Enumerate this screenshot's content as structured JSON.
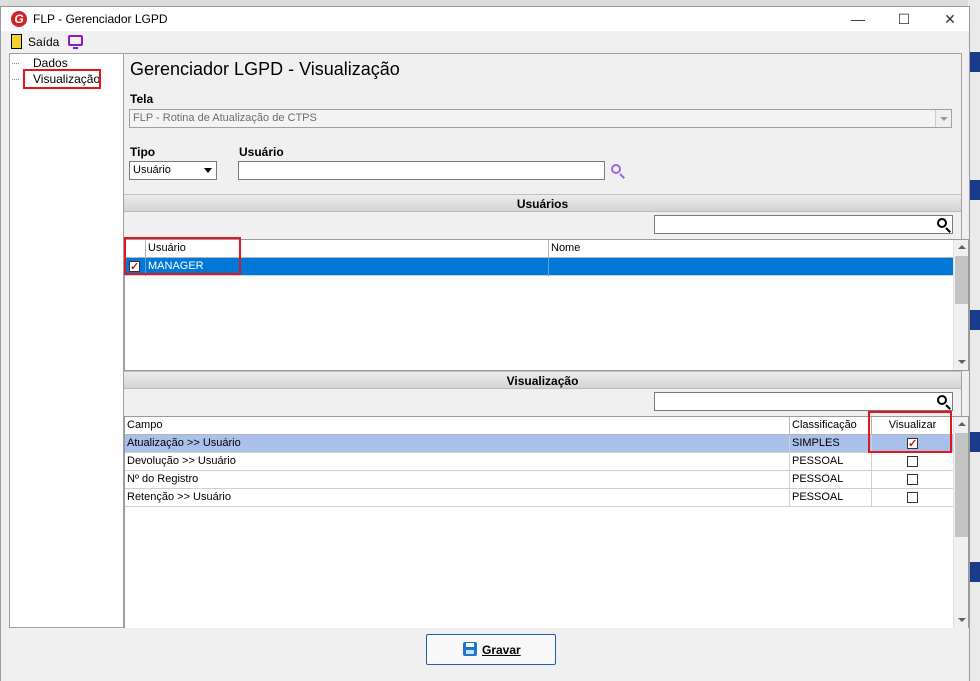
{
  "window": {
    "title": "FLP - Gerenciador LGPD",
    "logo_letter": "G",
    "controls": {
      "minimize": "—",
      "maximize": "☐",
      "close": "✕"
    }
  },
  "toolbar": {
    "exit_label": "Saída"
  },
  "tree": {
    "items": [
      {
        "label": "Dados"
      },
      {
        "label": "Visualização"
      }
    ]
  },
  "main": {
    "heading": "Gerenciador LGPD - Visualização",
    "tela_label": "Tela",
    "tela_value": "FLP - Rotina de Atualização de CTPS",
    "tipo_label": "Tipo",
    "tipo_value": "Usuário",
    "usuario_label": "Usuário",
    "usuario_value": ""
  },
  "usuarios": {
    "section_title": "Usuários",
    "columns": [
      "Usuário",
      "Nome"
    ],
    "rows": [
      {
        "usuario": "MANAGER",
        "nome": "",
        "checked": true
      }
    ]
  },
  "visualizacao": {
    "section_title": "Visualização",
    "columns": [
      "Campo",
      "Classificação",
      "Visualizar"
    ],
    "rows": [
      {
        "campo": "Atualização >> Usuário",
        "classificacao": "SIMPLES",
        "visualizar": true
      },
      {
        "campo": "Devolução >> Usuário",
        "classificacao": "PESSOAL",
        "visualizar": false
      },
      {
        "campo": "Nº do Registro",
        "classificacao": "PESSOAL",
        "visualizar": false
      },
      {
        "campo": "Retenção >> Usuário",
        "classificacao": "PESSOAL",
        "visualizar": false
      }
    ]
  },
  "footer": {
    "save_label": "Gravar"
  },
  "colors": {
    "selection": "#0078d7",
    "row_highlight": "#a9c1ea",
    "highlight_box": "#e0181e",
    "accent_purple": "#8a18c8"
  }
}
